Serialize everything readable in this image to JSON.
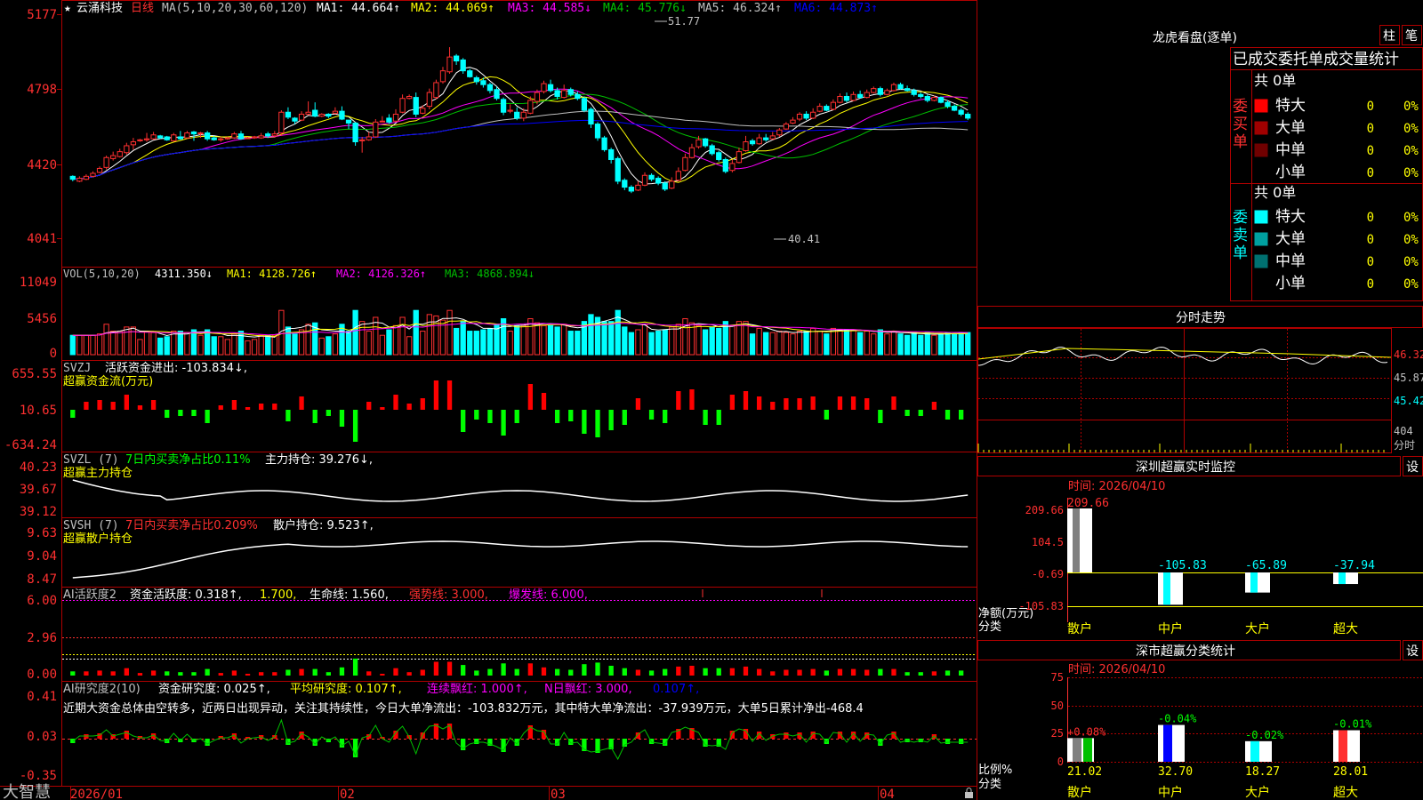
{
  "colors": {
    "up": "#ff3030",
    "down": "#00ffff",
    "grid": "#b00000",
    "bg": "#000000",
    "ma1": "#ffffff",
    "ma2": "#ffff00",
    "ma3": "#ff00ff",
    "ma4": "#00c000",
    "ma5": "#c0c0c0",
    "ma6": "#0000ff"
  },
  "header": {
    "star": "★",
    "stock_name": "云涌科技",
    "period": "日线",
    "ma_def": "MA(5,10,20,30,60,120)",
    "ma1": "MA1: 44.664↑",
    "ma2": "MA2: 44.069↑",
    "ma3": "MA3: 44.585↓",
    "ma4": "MA4: 45.776↓",
    "ma5": "MA5: 46.324↑",
    "ma6": "MA6: 44.873↑"
  },
  "price_axis": [
    "5177",
    "4798",
    "4420",
    "4041"
  ],
  "annotations": {
    "high": "51.77",
    "low": "40.41"
  },
  "vol_panel": {
    "label": "VOL(5,10,20)",
    "value": "4311.350↓",
    "ma1": "MA1: 4128.726↑",
    "ma2": "MA2: 4126.326↑",
    "ma3": "MA3: 4868.894↓",
    "axis": [
      "11049",
      "5456",
      "0"
    ]
  },
  "svzj_panel": {
    "label": "SVZJ",
    "text": "活跃资金进出: -103.834↓,",
    "sub": "超赢资金流(万元)",
    "axis": [
      "655.55",
      "10.65",
      "-634.24"
    ]
  },
  "svzl_panel": {
    "label": "SVZL (7)",
    "text1": "7日内买卖净占比0.11%",
    "text2": "主力持仓: 39.276↓,",
    "sub": "超赢主力持仓",
    "axis": [
      "40.23",
      "39.67",
      "39.12"
    ]
  },
  "svsh_panel": {
    "label": "SVSH (7)",
    "text1": "7日内买卖净占比0.209%",
    "text2": "散户持仓: 9.523↑,",
    "sub": "超赢散户持仓",
    "axis": [
      "9.63",
      "9.04",
      "8.47"
    ]
  },
  "ai_active_panel": {
    "label": "AI活跃度2",
    "t1": "资金活跃度: 0.318↑,",
    "t2": "1.700,",
    "t3": "生命线: 1.560,",
    "t4": "强势线: 3.000,",
    "t5": "爆发线: 6.000,",
    "axis": [
      "6.00",
      "2.96",
      "0.00"
    ]
  },
  "ai_research_panel": {
    "label": "AI研究度2(10)",
    "t1": "资金研究度: 0.025↑,",
    "t2": "平均研究度: 0.107↑,",
    "t3": "连续飘红: 1.000↑,",
    "t4": "N日飘红: 3.000,",
    "t5": "0.107↑,",
    "comment": "近期大资金总体由空转多，近两日出现异动，关注其持续性，今日大单净流出：-103.832万元，其中特大单净流出：-37.939万元，大单5日累计净出-468.4",
    "axis": [
      "0.41",
      "0.03",
      "-0.35"
    ]
  },
  "date_axis": [
    "2026/01",
    "02",
    "03",
    "04"
  ],
  "brand": "大智慧",
  "right": {
    "top_title": "龙虎看盘(逐单)",
    "btn_bar": "柱",
    "btn_pen": "笔",
    "stats_title": "已成交委托单成交量统计",
    "buy": {
      "side_label": "委买单",
      "total": "共 0单",
      "rows": [
        {
          "name": "特大",
          "count": "0",
          "pct": "0%",
          "color": "#ff0000"
        },
        {
          "name": "大单",
          "count": "0",
          "pct": "0%",
          "color": "#a00000"
        },
        {
          "name": "中单",
          "count": "0",
          "pct": "0%",
          "color": "#700000"
        },
        {
          "name": "小单",
          "count": "0",
          "pct": "0%",
          "color": "#000000"
        }
      ]
    },
    "sell": {
      "side_label": "委卖单",
      "total": "共 0单",
      "rows": [
        {
          "name": "特大",
          "count": "0",
          "pct": "0%",
          "color": "#00ffff"
        },
        {
          "name": "大单",
          "count": "0",
          "pct": "0%",
          "color": "#00a0a0"
        },
        {
          "name": "中单",
          "count": "0",
          "pct": "0%",
          "color": "#007070"
        },
        {
          "name": "小单",
          "count": "0",
          "pct": "0%",
          "color": "#000000"
        }
      ]
    },
    "intraday_title": "分时走势",
    "intraday_axis": [
      "46.32",
      "45.87",
      "45.42",
      "404",
      "分时"
    ],
    "monitor_title": "深圳超赢实时监控",
    "settings": "设",
    "monitor_time": "时间: 2026/04/10",
    "monitor_axis": [
      "209.66",
      "104.5",
      "-0.69",
      "-105.83"
    ],
    "monitor_ylabel": "净额(万元)",
    "monitor_xlabel": "分类",
    "monitor_values": [
      "209.66",
      "-105.83",
      "-65.89",
      "-37.94"
    ],
    "categories": [
      "散户",
      "中户",
      "大户",
      "超大"
    ],
    "class_title": "深市超赢分类统计",
    "class_time": "时间: 2026/04/10",
    "class_axis": [
      "75",
      "50",
      "25",
      "0"
    ],
    "class_ylabel": "比例%",
    "class_xlabel": "分类",
    "class_changes": [
      "+0.08%",
      "-0.04%",
      "-0.02%",
      "-0.01%"
    ],
    "class_values": [
      "21.02",
      "32.70",
      "18.27",
      "28.01"
    ]
  },
  "chart_data": [
    {
      "type": "candlestick",
      "title": "云涌科技 日线",
      "x": [
        "2026/01",
        "",
        "",
        "",
        "",
        "",
        "",
        "",
        "",
        "",
        "",
        "",
        "",
        "",
        "",
        "",
        "",
        "",
        "",
        "",
        "02",
        "",
        "",
        "",
        "",
        "",
        "",
        "",
        "",
        "",
        "",
        "",
        "",
        "",
        "03",
        "",
        "",
        "",
        "",
        "",
        "",
        "",
        "",
        "",
        "",
        "",
        "",
        "",
        "",
        "",
        "",
        "",
        "",
        "",
        "",
        "",
        "",
        "",
        "04",
        "",
        "",
        "",
        ""
      ],
      "ohlc": [
        [
          43.55,
          43.4,
          43.6,
          43.3
        ],
        [
          43.3,
          43.45,
          43.55,
          43.25
        ],
        [
          43.4,
          43.55,
          43.65,
          43.35
        ],
        [
          43.55,
          43.7,
          43.8,
          43.5
        ],
        [
          43.75,
          43.95,
          44.05,
          43.7
        ],
        [
          44.0,
          44.5,
          44.6,
          43.9
        ],
        [
          44.45,
          44.6,
          44.8,
          44.35
        ],
        [
          44.55,
          44.8,
          44.95,
          44.5
        ],
        [
          44.75,
          45.1,
          45.25,
          44.65
        ],
        [
          45.15,
          45.3,
          45.5,
          44.9
        ],
        [
          45.35,
          45.4,
          45.45,
          45.3
        ],
        [
          45.4,
          45.45,
          45.75,
          45.3
        ],
        [
          45.45,
          45.65,
          45.8,
          45.4
        ],
        [
          45.6,
          45.5,
          45.65,
          45.45
        ],
        [
          45.55,
          45.4,
          45.6,
          45.35
        ],
        [
          45.35,
          45.65,
          45.75,
          45.3
        ],
        [
          45.55,
          45.45,
          45.85,
          45.4
        ],
        [
          45.5,
          45.75,
          45.85,
          45.45
        ],
        [
          45.8,
          45.7,
          45.85,
          45.35
        ],
        [
          45.75,
          45.75,
          45.8,
          45.5
        ],
        [
          45.75,
          45.45,
          45.85,
          45.35
        ],
        [
          45.5,
          45.4,
          45.6,
          45.35
        ],
        [
          45.4,
          45.45,
          45.55,
          45.3
        ],
        [
          45.45,
          45.5,
          45.55,
          45.4
        ],
        [
          45.5,
          45.7,
          45.8,
          45.45
        ],
        [
          45.7,
          45.45,
          45.85,
          45.4
        ],
        [
          45.5,
          45.5,
          45.55,
          45.45
        ],
        [
          45.5,
          45.55,
          45.6,
          45.45
        ],
        [
          45.5,
          45.6,
          45.75,
          45.45
        ],
        [
          45.7,
          45.6,
          45.8,
          45.5
        ],
        [
          45.6,
          45.7,
          45.85,
          45.55
        ],
        [
          45.75,
          46.8,
          46.9,
          45.6
        ],
        [
          46.8,
          46.55,
          47.05,
          46.45
        ],
        [
          46.5,
          46.35,
          46.55,
          46.2
        ],
        [
          46.4,
          46.7,
          46.85,
          46.35
        ],
        [
          46.7,
          46.8,
          47.35,
          46.65
        ],
        [
          46.9,
          46.6,
          47.3,
          46.55
        ],
        [
          46.6,
          46.7,
          46.75,
          46.55
        ],
        [
          46.7,
          46.6,
          46.75,
          46.5
        ],
        [
          46.75,
          46.85,
          47.05,
          46.7
        ],
        [
          46.85,
          46.45,
          47.1,
          46.4
        ],
        [
          46.4,
          46.25,
          46.4,
          45.95
        ],
        [
          46.25,
          45.3,
          46.3,
          45.1
        ],
        [
          45.35,
          45.4,
          45.55,
          44.75
        ],
        [
          45.4,
          45.55,
          45.8,
          45.35
        ],
        [
          45.55,
          46.3,
          46.45,
          45.5
        ],
        [
          46.35,
          46.35,
          46.6,
          46.3
        ],
        [
          46.5,
          46.3,
          46.7,
          46.2
        ],
        [
          46.35,
          46.7,
          46.95,
          46.3
        ],
        [
          46.8,
          47.5,
          47.7,
          46.75
        ],
        [
          47.5,
          47.6,
          47.7,
          47.45
        ],
        [
          47.55,
          46.7,
          47.8,
          46.55
        ],
        [
          46.75,
          47.0,
          47.15,
          46.7
        ],
        [
          47.1,
          47.8,
          48.0,
          46.95
        ],
        [
          47.55,
          48.3,
          48.45,
          47.45
        ],
        [
          48.35,
          48.9,
          49.1,
          48.25
        ],
        [
          48.85,
          49.6,
          50.1,
          48.75
        ],
        [
          49.65,
          49.4,
          49.75,
          49.2
        ],
        [
          49.45,
          48.9,
          49.55,
          48.75
        ],
        [
          48.9,
          48.6,
          49.0,
          48.55
        ],
        [
          48.55,
          48.35,
          48.65,
          48.2
        ],
        [
          48.4,
          48.2,
          48.55,
          48.05
        ],
        [
          48.2,
          47.9,
          48.3,
          47.75
        ],
        [
          47.95,
          47.5,
          48.1,
          47.4
        ],
        [
          47.45,
          46.8,
          47.55,
          46.65
        ],
        [
          46.85,
          46.9,
          47.2,
          46.75
        ],
        [
          46.8,
          46.5,
          47.05,
          46.4
        ],
        [
          46.5,
          46.8,
          47.0,
          46.35
        ],
        [
          46.75,
          47.4,
          47.6,
          46.7
        ],
        [
          47.35,
          47.8,
          47.95,
          47.2
        ],
        [
          47.85,
          48.25,
          48.4,
          47.75
        ],
        [
          48.2,
          47.9,
          48.45,
          47.8
        ],
        [
          47.9,
          47.6,
          48.05,
          47.45
        ],
        [
          47.55,
          47.9,
          48.2,
          47.5
        ],
        [
          47.95,
          47.7,
          48.05,
          47.6
        ],
        [
          47.7,
          47.5,
          47.85,
          47.4
        ],
        [
          47.5,
          46.9,
          47.6,
          46.8
        ],
        [
          46.95,
          46.2,
          47.05,
          46.0
        ],
        [
          46.2,
          45.5,
          46.3,
          45.35
        ],
        [
          45.5,
          44.9,
          45.6,
          44.8
        ],
        [
          44.9,
          44.4,
          45.0,
          44.2
        ],
        [
          44.45,
          43.3,
          44.55,
          43.15
        ],
        [
          43.35,
          43.0,
          43.45,
          42.85
        ],
        [
          43.0,
          42.8,
          43.1,
          42.7
        ],
        [
          42.85,
          43.1,
          43.3,
          42.8
        ],
        [
          43.1,
          43.6,
          43.75,
          43.05
        ],
        [
          43.6,
          43.4,
          43.7,
          43.3
        ],
        [
          43.45,
          43.2,
          43.55,
          43.1
        ],
        [
          43.2,
          42.9,
          43.3,
          42.8
        ],
        [
          42.95,
          43.3,
          43.5,
          42.9
        ],
        [
          43.35,
          43.8,
          44.0,
          43.3
        ],
        [
          43.85,
          44.5,
          44.7,
          43.8
        ],
        [
          44.5,
          45.0,
          45.2,
          44.45
        ],
        [
          45.05,
          45.4,
          45.6,
          44.95
        ],
        [
          45.45,
          45.1,
          45.5,
          45.0
        ],
        [
          45.1,
          44.7,
          45.2,
          44.6
        ],
        [
          44.75,
          44.4,
          44.85,
          44.3
        ],
        [
          44.4,
          43.8,
          44.5,
          43.7
        ],
        [
          43.85,
          44.2,
          44.4,
          43.75
        ],
        [
          44.25,
          44.8,
          45.0,
          44.2
        ],
        [
          44.85,
          45.3,
          45.6,
          44.8
        ],
        [
          45.35,
          45.2,
          45.45,
          45.1
        ],
        [
          45.2,
          45.5,
          45.7,
          45.15
        ],
        [
          45.5,
          45.4,
          45.7,
          45.3
        ],
        [
          45.45,
          45.6,
          45.8,
          45.4
        ],
        [
          45.65,
          45.9,
          46.0,
          45.55
        ],
        [
          45.95,
          46.2,
          46.3,
          45.9
        ],
        [
          46.25,
          46.4,
          46.55,
          46.2
        ],
        [
          46.45,
          46.7,
          46.8,
          46.35
        ],
        [
          46.7,
          46.5,
          46.85,
          46.4
        ],
        [
          46.5,
          46.8,
          47.0,
          46.45
        ],
        [
          46.85,
          47.1,
          47.25,
          46.8
        ],
        [
          47.1,
          46.9,
          47.2,
          46.85
        ],
        [
          46.95,
          47.3,
          47.45,
          46.9
        ],
        [
          47.3,
          47.6,
          47.75,
          47.25
        ],
        [
          47.6,
          47.4,
          47.8,
          47.3
        ],
        [
          47.4,
          47.7,
          47.85,
          47.35
        ],
        [
          47.7,
          47.55,
          47.9,
          47.5
        ],
        [
          47.55,
          47.8,
          47.95,
          47.5
        ],
        [
          47.8,
          48.0,
          48.1,
          47.75
        ],
        [
          48.0,
          47.7,
          48.1,
          47.6
        ],
        [
          47.7,
          47.9,
          48.0,
          47.65
        ],
        [
          47.9,
          48.2,
          48.3,
          47.85
        ],
        [
          48.2,
          48.0,
          48.3,
          47.95
        ],
        [
          48.0,
          47.9,
          48.15,
          47.85
        ],
        [
          47.9,
          47.7,
          48.0,
          47.6
        ],
        [
          47.7,
          47.6,
          47.8,
          47.5
        ],
        [
          47.6,
          47.4,
          47.7,
          47.3
        ],
        [
          47.4,
          47.55,
          47.65,
          47.35
        ],
        [
          47.55,
          47.3,
          47.6,
          47.25
        ],
        [
          47.3,
          47.1,
          47.4,
          47.0
        ],
        [
          47.1,
          46.9,
          47.2,
          46.85
        ],
        [
          46.9,
          46.7,
          47.0,
          46.6
        ],
        [
          46.7,
          46.5,
          46.8,
          46.4
        ]
      ],
      "ylim": [
        40.41,
        51.77
      ]
    }
  ]
}
